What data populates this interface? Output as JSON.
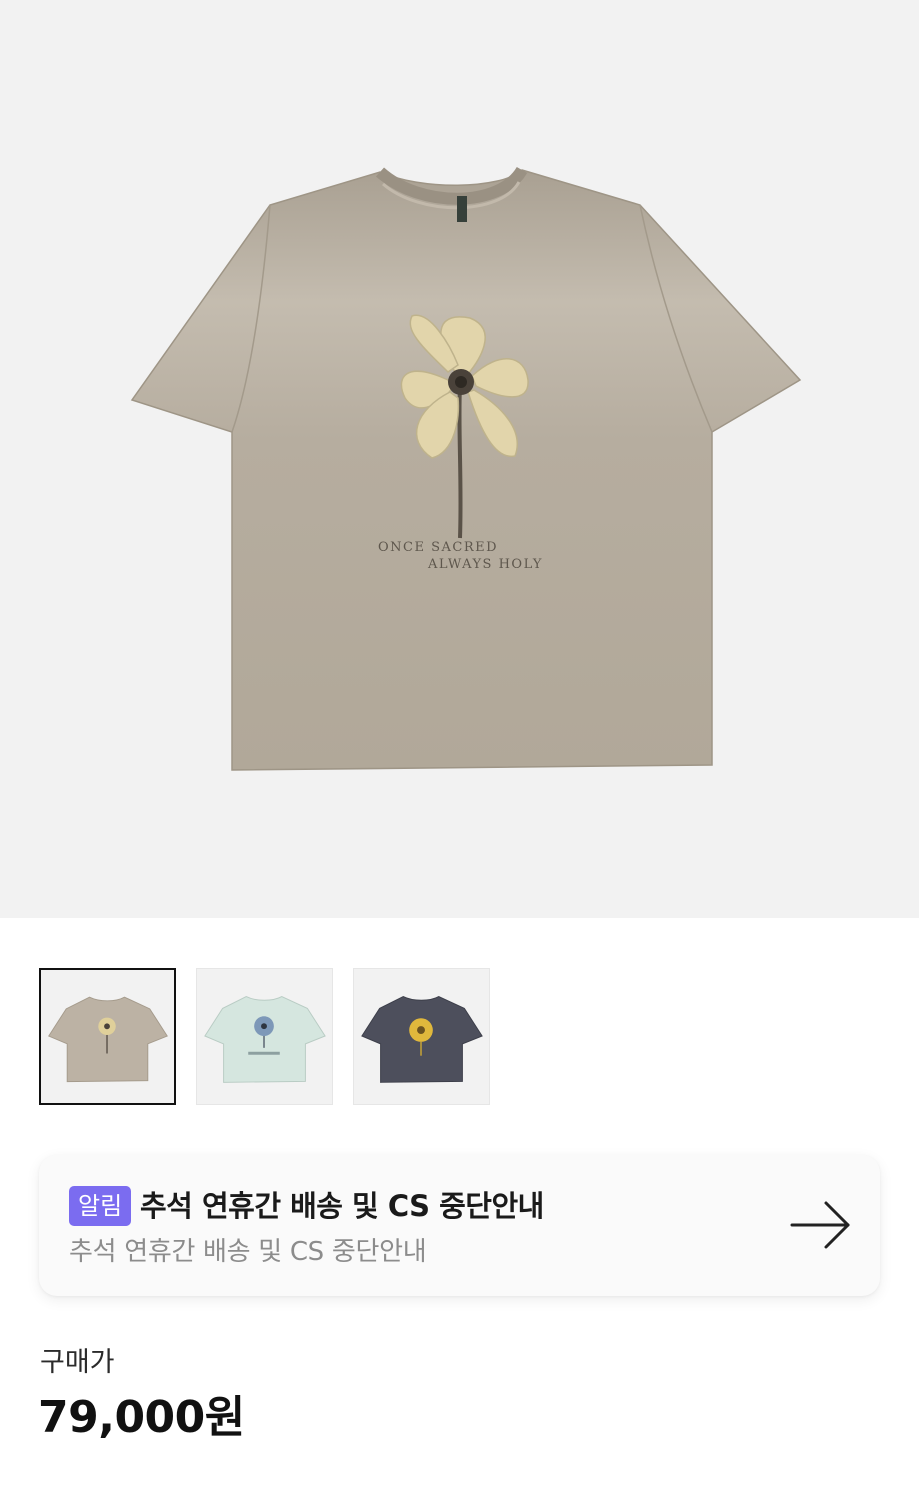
{
  "product": {
    "shirt_print_line1": "ONCE SACRED",
    "shirt_print_line2": "ALWAYS HOLY",
    "colors": {
      "hero_background": "#f2f2f2",
      "shirt_beige": "#b3aa9c",
      "flower_cream": "#e2d5ab"
    }
  },
  "thumbnails": [
    {
      "variant": "beige",
      "shirt_color": "#bcb2a4",
      "flower_color": "#e0d09a",
      "selected": true
    },
    {
      "variant": "mint",
      "shirt_color": "#d5e6df",
      "flower_color": "#7d98b8",
      "selected": false
    },
    {
      "variant": "charcoal",
      "shirt_color": "#4d4f5c",
      "flower_color": "#e0b83c",
      "selected": false
    }
  ],
  "notice": {
    "badge": "알림",
    "title": "추석 연휴간 배송 및 CS 중단안내",
    "subtitle": "추석 연휴간 배송 및 CS 중단안내",
    "badge_color": "#7b6cf0",
    "arrow_icon": "arrow-right-icon"
  },
  "price": {
    "label": "구매가",
    "value": "79,000원"
  }
}
